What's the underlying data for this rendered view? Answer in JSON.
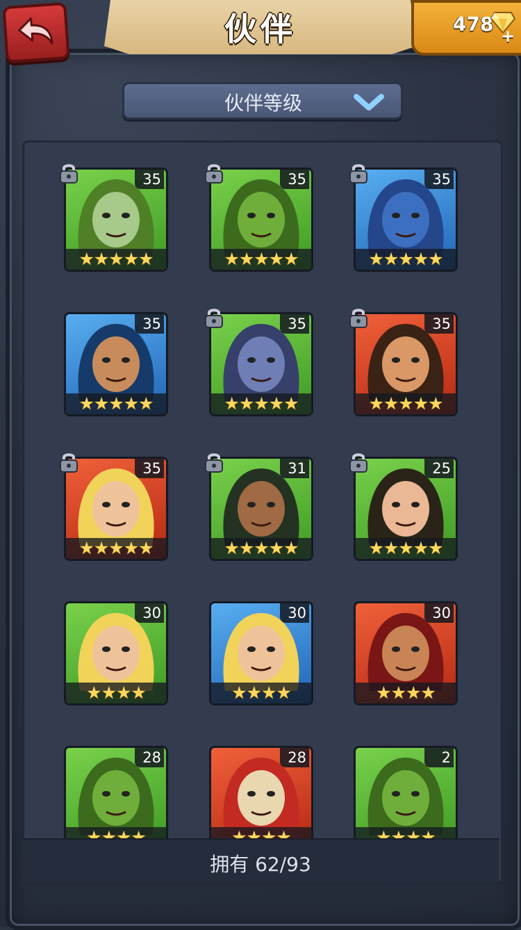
{
  "header": {
    "title": "伙伴",
    "gems": "478"
  },
  "sort": {
    "label": "伙伴等级"
  },
  "companions": [
    {
      "level": "35",
      "stars": "★★★★★",
      "bg": "green",
      "locked": true,
      "face": "#a7c98a",
      "hair": "#4f7f26"
    },
    {
      "level": "35",
      "stars": "★★★★★",
      "bg": "green",
      "locked": true,
      "face": "#6fae3a",
      "hair": "#3c6b1e"
    },
    {
      "level": "35",
      "stars": "★★★★★",
      "bg": "blue",
      "locked": true,
      "face": "#3d6fc0",
      "hair": "#24468a"
    },
    {
      "level": "35",
      "stars": "★★★★★",
      "bg": "blue",
      "locked": false,
      "face": "#c88c5c",
      "hair": "#163b6a"
    },
    {
      "level": "35",
      "stars": "★★★★★",
      "bg": "green",
      "locked": true,
      "face": "#6f7fb6",
      "hair": "#37406a"
    },
    {
      "level": "35",
      "stars": "★★★★★",
      "bg": "red",
      "locked": true,
      "face": "#d99866",
      "hair": "#3a2214"
    },
    {
      "level": "35",
      "stars": "★★★★★",
      "bg": "red",
      "locked": true,
      "face": "#efc39a",
      "hair": "#f2d35a"
    },
    {
      "level": "31",
      "stars": "★★★★★",
      "bg": "green",
      "locked": true,
      "face": "#a06a44",
      "hair": "#243222"
    },
    {
      "level": "25",
      "stars": "★★★★★",
      "bg": "green",
      "locked": true,
      "face": "#eab894",
      "hair": "#2a2418"
    },
    {
      "level": "30",
      "stars": "★★★★",
      "bg": "green",
      "locked": false,
      "face": "#efc39a",
      "hair": "#f2d35a"
    },
    {
      "level": "30",
      "stars": "★★★★",
      "bg": "blue",
      "locked": false,
      "face": "#efc39a",
      "hair": "#f2d35a"
    },
    {
      "level": "30",
      "stars": "★★★★",
      "bg": "red",
      "locked": false,
      "face": "#c98456",
      "hair": "#7a1616"
    },
    {
      "level": "28",
      "stars": "★★★★",
      "bg": "green",
      "locked": false,
      "face": "#6fae3a",
      "hair": "#3c6b1e"
    },
    {
      "level": "28",
      "stars": "★★★★",
      "bg": "red",
      "locked": false,
      "face": "#e9d7b0",
      "hair": "#c22a22"
    },
    {
      "level": "2",
      "stars": "★★★★",
      "bg": "green",
      "locked": false,
      "face": "#6fae3a",
      "hair": "#3c6b1e"
    }
  ],
  "footer": {
    "owned": "拥有 62/93"
  }
}
